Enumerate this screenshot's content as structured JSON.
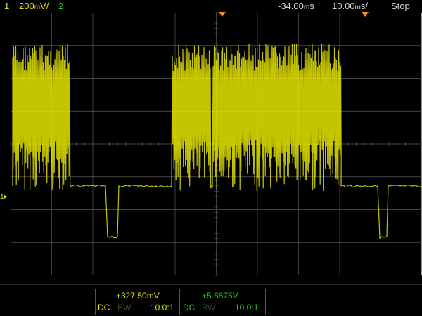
{
  "header": {
    "ch1_label": "1",
    "ch1_scale": "200̅′/",
    "ch2_label": "2",
    "time_offset": "-34.00s",
    "time_scale": "10.00s/",
    "run_state": "Stop"
  },
  "footer": {
    "ch1_offset": "+327.50mV",
    "ch2_offset": "+5.6875V",
    "ch1_coupling": "DC",
    "ch1_bw": "BW",
    "ch1_probe": "10.0:1",
    "ch2_coupling": "DC",
    "ch2_bw": "BW",
    "ch2_probe": "10.0:1"
  },
  "ground_label": "1",
  "colors": {
    "ch1": "#e6e600",
    "ch2": "#22c922",
    "trigger_marker": "#ff8c1a",
    "grid": "#5a5a5a"
  }
}
